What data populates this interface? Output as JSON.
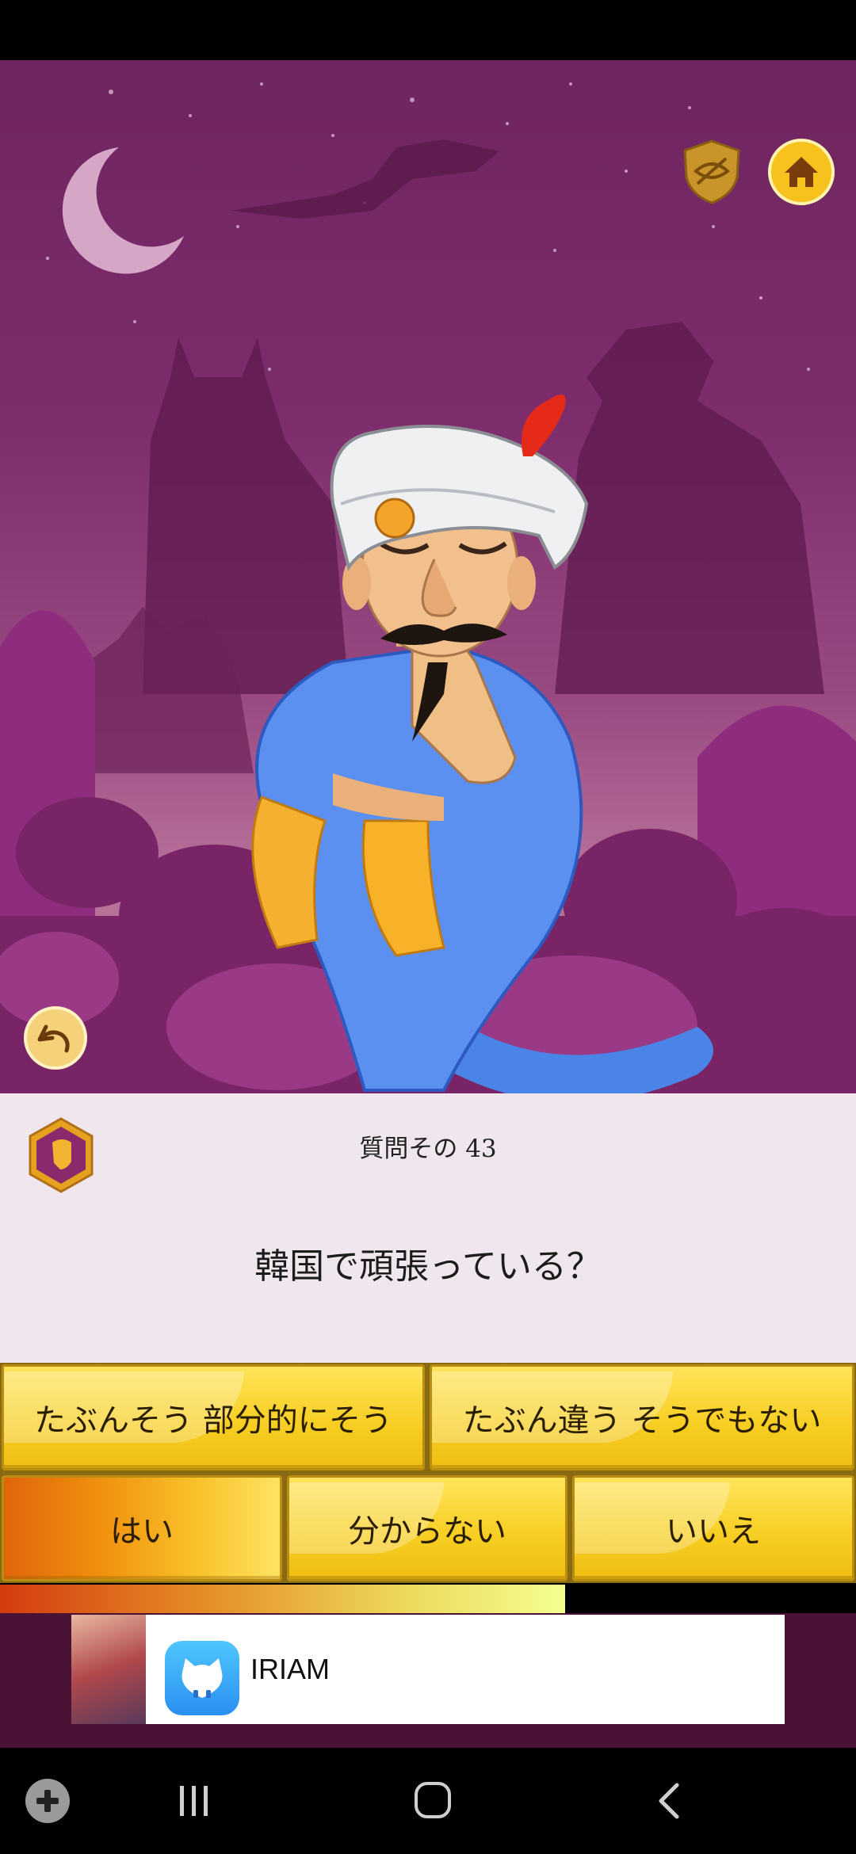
{
  "game": {
    "question_number": "質問その 43",
    "question_text": "韓国で頑張っている？"
  },
  "answers": {
    "probably": "たぶんそう 部分的にそう",
    "probably_not": "たぶん違う そうでもない",
    "yes": "はい",
    "dont_know": "分からない",
    "no": "いいえ"
  },
  "progress": {
    "value_percent": 66
  },
  "ad": {
    "app_name": "IRIAM"
  },
  "colors": {
    "scene": "#7d2d6c",
    "button_yellow": "#f7cf24",
    "panel": "#f0e6ee"
  },
  "icons": [
    "hide-icon",
    "home-icon",
    "undo-icon",
    "badge-icon",
    "game-launcher-icon",
    "recents-icon",
    "home-nav-icon",
    "back-icon"
  ]
}
